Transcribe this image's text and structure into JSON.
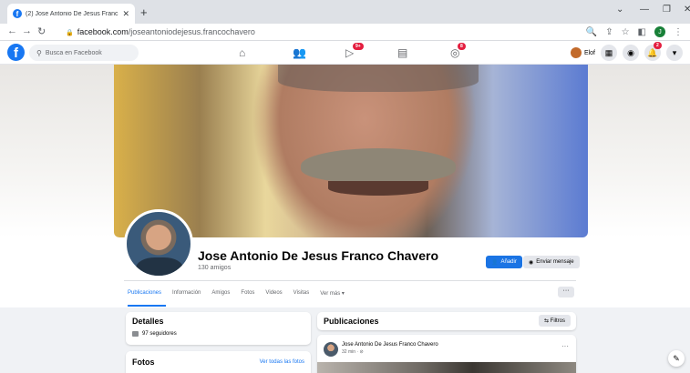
{
  "browser": {
    "tab_title": "(2) Jose Antonio De Jesus Franc",
    "tab_close": "✕",
    "new_tab": "+",
    "url_host": "facebook.com",
    "url_path": "/joseantoniodejesus.francochavero",
    "profile_initial": "J"
  },
  "fb": {
    "search_placeholder": "Busca en Facebook",
    "nav_badges": {
      "video": "9+",
      "gaming": "8"
    },
    "me_name": "Elof",
    "notif_badge": "2"
  },
  "profile": {
    "name": "Jose Antonio De Jesus Franco Chavero",
    "friends": "130 amigos",
    "add_label": "Añadir",
    "message_label": "Enviar mensaje",
    "tabs": [
      "Publicaciones",
      "Información",
      "Amigos",
      "Fotos",
      "Videos",
      "Visitas",
      "Ver más ▾"
    ],
    "more": "···"
  },
  "details": {
    "title": "Detalles",
    "followers": "97 seguidores"
  },
  "photos": {
    "title": "Fotos",
    "see_all": "Ver todas las fotos"
  },
  "posts": {
    "title": "Publicaciones",
    "filters": "⇆ Filtros",
    "author": "Jose Antonio De Jesus Franco Chavero",
    "time": "32 min · ⊘",
    "more": "···"
  },
  "colors": {
    "brand": "#1877f2",
    "badge": "#e41e3f"
  }
}
